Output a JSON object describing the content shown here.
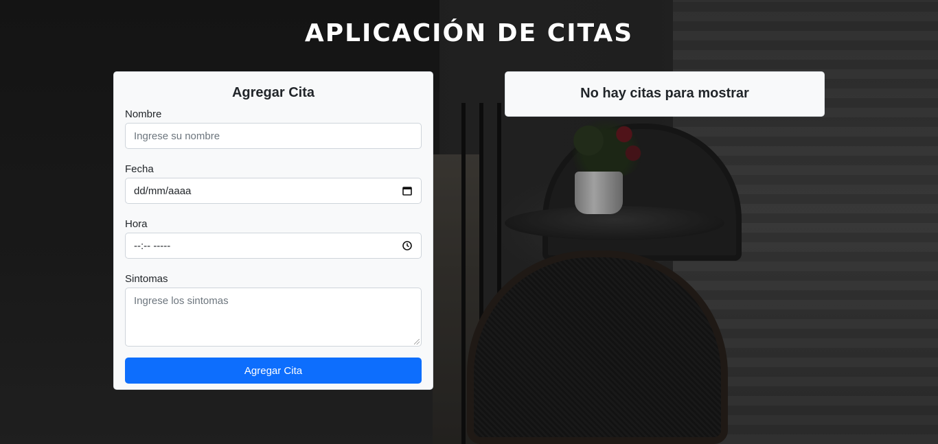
{
  "header": {
    "title": "APLICACIÓN DE CITAS"
  },
  "form": {
    "title": "Agregar Cita",
    "fields": {
      "nombre": {
        "label": "Nombre",
        "placeholder": "Ingrese su nombre"
      },
      "fecha": {
        "label": "Fecha",
        "value": "dd/mm/aaaa",
        "icon": "calendar-icon"
      },
      "hora": {
        "label": "Hora",
        "value": "--:-- -----",
        "icon": "clock-icon"
      },
      "sintomas": {
        "label": "Sintomas",
        "placeholder": "Ingrese los sintomas"
      }
    },
    "submit_label": "Agregar Cita",
    "accent_color": "#0d6efd"
  },
  "list": {
    "empty_message": "No hay citas para mostrar"
  }
}
